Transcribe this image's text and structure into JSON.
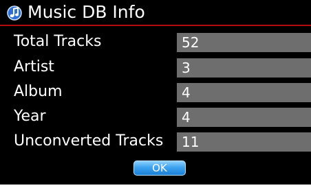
{
  "dialog": {
    "title": "Music DB Info",
    "title_icon": "music-note-icon",
    "accent_color": "#b30d0d",
    "value_background": "#6e6e6e",
    "rows": [
      {
        "label": "Total Tracks",
        "value": "52"
      },
      {
        "label": "Artist",
        "value": "3"
      },
      {
        "label": "Album",
        "value": "4"
      },
      {
        "label": "Year",
        "value": "4"
      },
      {
        "label": "Unconverted Tracks",
        "value": "11"
      }
    ],
    "ok_label": "OK"
  }
}
